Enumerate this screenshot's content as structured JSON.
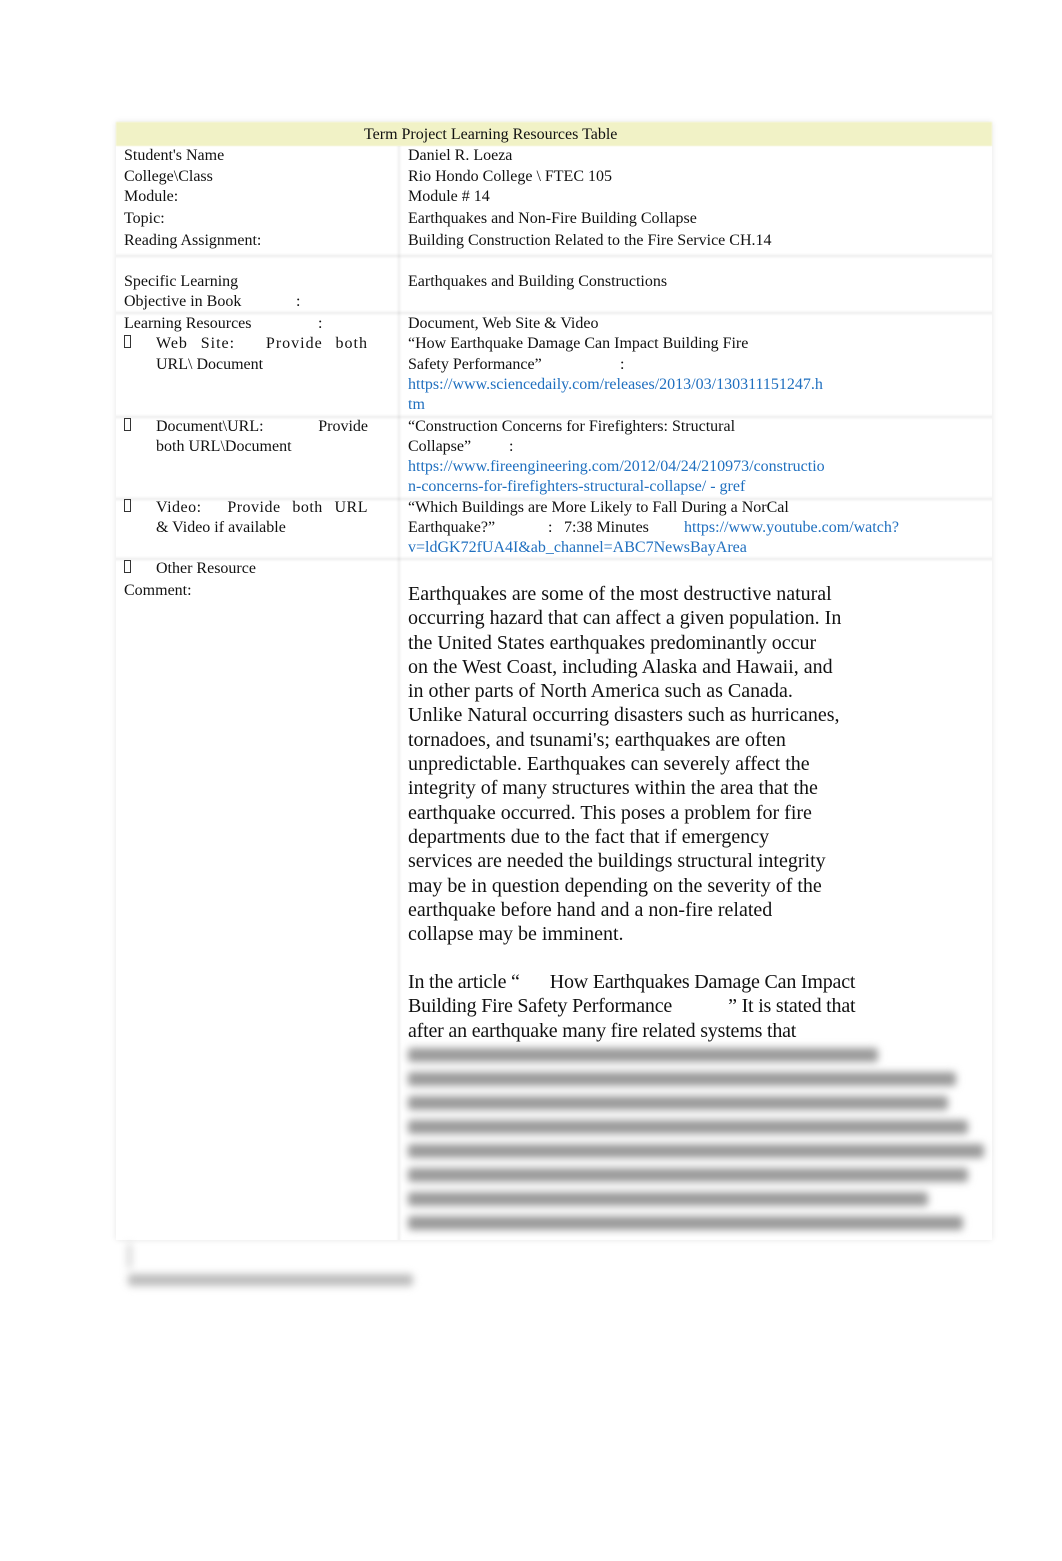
{
  "header": {
    "title": "Term Project Learning Resources Table"
  },
  "rows": {
    "student_name": {
      "label": "Student's Name",
      "value": "Daniel R. Loeza"
    },
    "college_class": {
      "label": "College\\Class",
      "value": "Rio Hondo College \\ FTEC 105"
    },
    "module": {
      "label": "Module:",
      "value": "Module # 14"
    },
    "topic": {
      "label": "Topic:",
      "value": "Earthquakes and Non-Fire Building Collapse"
    },
    "reading": {
      "label": "Reading Assignment:",
      "value": "Building Construction Related to the Fire Service CH.14"
    },
    "objective": {
      "label_line1": "Specific Learning",
      "label_line2": "Objective in Book",
      "label_colon": ":",
      "value": "Earthquakes and Building Constructions"
    },
    "resources": {
      "label": "Learning Resources",
      "label_colon": ":",
      "value": "Document, Web Site & Video"
    }
  },
  "bullets": {
    "icon": "missing-glyph-bullet",
    "website": {
      "label_words": [
        "Web",
        "Site:",
        "Provide",
        "both"
      ],
      "label_line2": "URL\\ Document",
      "title_line1": "“How Earthquake Damage Can Impact Building Fire",
      "title_line2": "Safety Performance”",
      "colon": ":",
      "url_line1": "https://www.sciencedaily.com/releases/2013/03/130311151247.h",
      "url_line2": "tm"
    },
    "document": {
      "label_words": [
        "Document\\URL:",
        "Provide"
      ],
      "label_line2": "both URL\\Document",
      "title_line1": "“Construction Concerns for Firefighters: Structural",
      "title_line2": "Collapse”",
      "colon": ":",
      "url_line1": "https://www.fireengineering.com/2012/04/24/210973/constructio",
      "url_line2": "n-concerns-for-firefighters-structural-collapse/ - gref"
    },
    "video": {
      "label_words": [
        "Video:",
        "Provide",
        "both",
        "URL"
      ],
      "label_line2": "& Video if available",
      "title_line1": "“Which Buildings are More Likely to Fall During a NorCal",
      "title_line2": "Earthquake?”",
      "colon": ":",
      "duration": "7:38 Minutes",
      "url_line1": "https://www.youtube.com/watch?",
      "url_line2": "v=ldGK72fUA4I&ab_channel=ABC7NewsBayArea"
    },
    "other": {
      "label": "Other Resource"
    }
  },
  "comment": {
    "label": "Comment:",
    "paragraph1_lines": [
      "Earthquakes are some of the most destructive natural",
      "occurring hazard that can affect a given population. In",
      "the United States earthquakes predominantly occur",
      "on the West Coast, including Alaska and Hawaii, and",
      "in other parts of North America such as Canada.",
      "Unlike Natural occurring disasters such as hurricanes,",
      "tornadoes, and tsunami's; earthquakes are often",
      "unpredictable. Earthquakes can severely affect the",
      "integrity of many structures within the area that the",
      "earthquake occurred. This poses a problem for fire",
      "departments due to the fact that if emergency",
      "services are needed the buildings structural integrity",
      "may be in question depending on the severity of the",
      "earthquake before hand and a non-fire related",
      "collapse may be imminent."
    ],
    "paragraph2": {
      "open": "In the article “",
      "title_line1": "How Earthquakes Damage Can Impact",
      "title_line2": "Building Fire Safety Performance",
      "close": "” It is stated that",
      "line3": "after an earthquake many fire related systems that"
    }
  },
  "colors": {
    "header_band": "#f1f2c6",
    "link": "#1f6fbf",
    "text": "#111111"
  }
}
